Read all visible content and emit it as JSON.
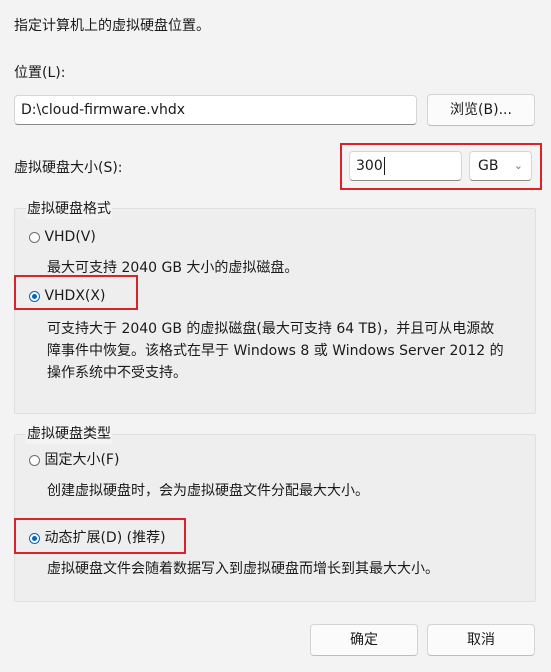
{
  "intro_text": "指定计算机上的虚拟硬盘位置。",
  "location": {
    "label": "位置(L):",
    "value": "D:\\cloud-firmware.vhdx",
    "browse_button": "浏览(B)..."
  },
  "size": {
    "label": "虚拟硬盘大小(S):",
    "value": "300",
    "unit": "GB"
  },
  "format_group": {
    "title": "虚拟硬盘格式",
    "options": [
      {
        "label": "VHD(V)",
        "description": "最大可支持 2040 GB 大小的虚拟磁盘。",
        "selected": false
      },
      {
        "label": "VHDX(X)",
        "description_lines": [
          "可支持大于 2040 GB 的虚拟磁盘(最大可支持 64 TB)，并且可从电源故",
          "障事件中恢复。该格式在早于 Windows 8 或 Windows Server 2012 的",
          "操作系统中不受支持。"
        ],
        "selected": true
      }
    ]
  },
  "type_group": {
    "title": "虚拟硬盘类型",
    "options": [
      {
        "label": "固定大小(F)",
        "description": "创建虚拟硬盘时，会为虚拟硬盘文件分配最大大小。",
        "selected": false
      },
      {
        "label": "动态扩展(D) (推荐)",
        "description": "虚拟硬盘文件会随着数据写入到虚拟硬盘而增长到其最大大小。",
        "selected": true
      }
    ]
  },
  "buttons": {
    "ok": "确定",
    "cancel": "取消"
  },
  "colors": {
    "accent": "#0067c0",
    "highlight": "#d9222a"
  }
}
